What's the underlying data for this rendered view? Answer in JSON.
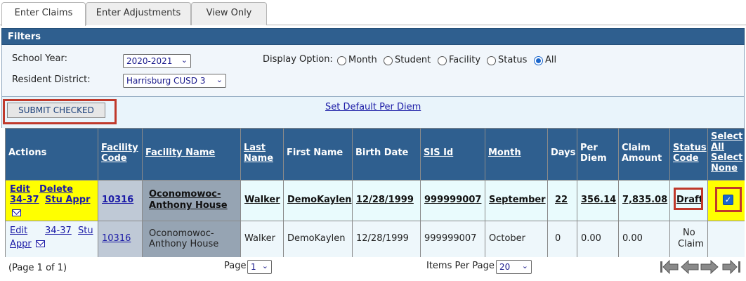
{
  "tabs": [
    "Enter Claims",
    "Enter Adjustments",
    "View Only"
  ],
  "filters": {
    "title": "Filters",
    "school_year_label": "School Year:",
    "school_year_value": "2020-2021",
    "resident_district_label": "Resident District:",
    "resident_district_value": "Harrisburg CUSD 3",
    "display_option_label": "Display Option:",
    "display_options": [
      "Month",
      "Student",
      "Facility",
      "Status",
      "All"
    ],
    "display_selected": "All"
  },
  "actions": {
    "submit_checked": "SUBMIT CHECKED",
    "set_default": "Set Default Per Diem"
  },
  "table": {
    "headers": {
      "actions": "Actions",
      "facility_code": [
        "Facility",
        "Code"
      ],
      "facility_name": "Facility Name",
      "last_name": [
        "Last",
        "Name"
      ],
      "first_name": "First Name",
      "birth_date": "Birth Date",
      "sis_id": "SIS Id",
      "month": "Month",
      "days": "Days",
      "per_diem": [
        "Per",
        "Diem"
      ],
      "claim_amount": [
        "Claim",
        "Amount"
      ],
      "status_code": [
        "Status",
        "Code"
      ],
      "select": [
        "Select",
        "All",
        "Select",
        "None"
      ]
    },
    "rows": [
      {
        "actions": [
          "Edit",
          "Delete",
          "34-37",
          "Stu Appr"
        ],
        "facility_code": "10316",
        "facility_name": [
          "Oconomowoc-",
          "Anthony House"
        ],
        "last_name": "Walker",
        "first_name": "DemoKaylen",
        "birth_date": "12/28/1999",
        "sis_id": "999999007",
        "month": "September",
        "days": "22",
        "per_diem": "356.14",
        "claim_amount": "7,835.08",
        "status": "Draft",
        "checked": true
      },
      {
        "actions": [
          "Edit",
          "34-37",
          "Stu",
          "Appr"
        ],
        "facility_code": "10316",
        "facility_name": [
          "Oconomowoc-",
          "Anthony House"
        ],
        "last_name": "Walker",
        "first_name": "DemoKaylen",
        "birth_date": "12/28/1999",
        "sis_id": "999999007",
        "month": "October",
        "days": "0",
        "per_diem": "0.00",
        "claim_amount": "0.00",
        "status": [
          "No",
          "Claim"
        ],
        "checked": false
      }
    ]
  },
  "footer": {
    "page_info": "(Page 1 of 1)",
    "page_label": "Page",
    "page_value": "1",
    "items_per_page_label": "Items Per Page",
    "items_per_page_value": "20"
  },
  "colors": {
    "header_blue": "#2f5f8f",
    "highlight_yellow": "#ffff00",
    "annotation_red": "#c0392b",
    "link_blue": "#1a1aa6"
  },
  "icons": [
    "mail-icon",
    "first-page-icon",
    "previous-page-icon",
    "next-page-icon",
    "last-page-icon"
  ]
}
